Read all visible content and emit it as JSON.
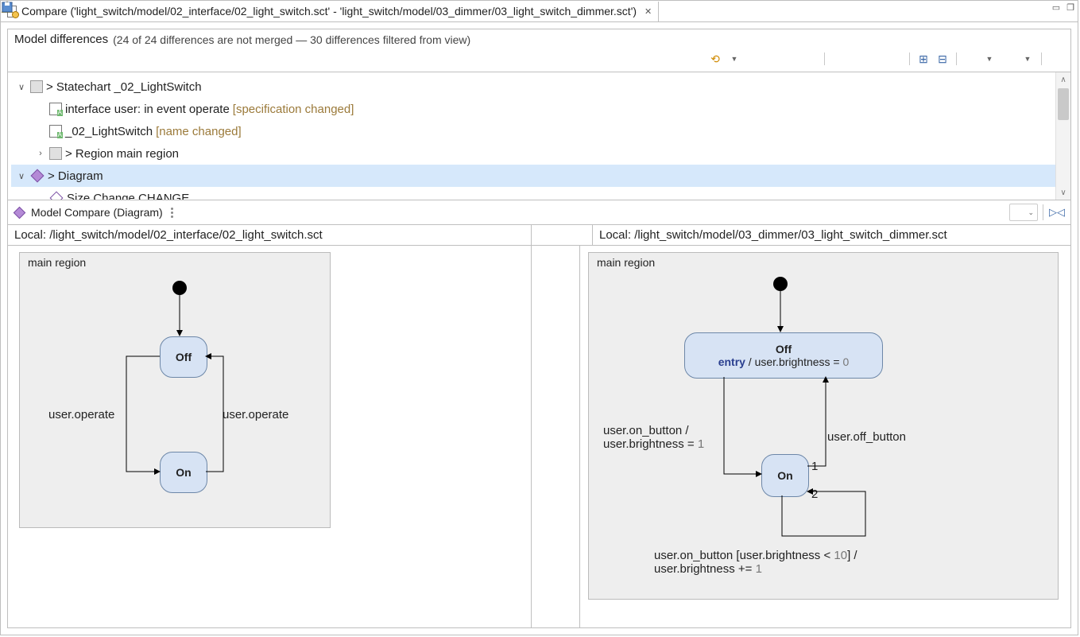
{
  "tab": {
    "title": "Compare ('light_switch/model/02_interface/02_light_switch.sct' - 'light_switch/model/03_dimmer/03_light_switch_dimmer.sct')"
  },
  "header": {
    "title": "Model differences",
    "summary": "(24 of 24 differences are not merged — 30 differences filtered from view)"
  },
  "toolbar": {
    "icons": [
      "undo",
      "dropdown",
      "copy-la",
      "copy-ra",
      "copy-all-l",
      "copy-all-r",
      "sep",
      "accept-l",
      "accept-r",
      "reject-l",
      "reject-r",
      "sep",
      "expand",
      "collapse",
      "sep",
      "group",
      "dropdown",
      "filter",
      "dropdown",
      "sep",
      "save"
    ]
  },
  "tree": {
    "r0_label": "> Statechart _02_LightSwitch",
    "r1_label": "interface user: in event operate",
    "r1_note": "[specification changed]",
    "r2_label": "_02_LightSwitch",
    "r2_note": "[name changed]",
    "r3_label": "> Region main region",
    "r4_label": "> Diagram",
    "r5_label": "Size Change CHANGE"
  },
  "midbar": {
    "title": "Model Compare (Diagram)"
  },
  "paths": {
    "left": "Local: /light_switch/model/02_interface/02_light_switch.sct",
    "right": "Local: /light_switch/model/03_dimmer/03_light_switch_dimmer.sct"
  },
  "left_chart": {
    "region": "main region",
    "off": "Off",
    "on": "On",
    "t1": "user.operate",
    "t2": "user.operate"
  },
  "right_chart": {
    "region": "main region",
    "off": "Off",
    "on": "On",
    "entry_kw": "entry",
    "entry_rest": " / user.brightness = ",
    "entry_zero": "0",
    "t1a": "user.on_button /",
    "t1b": "user.brightness = ",
    "one": "1",
    "t2": "user.off_button",
    "t3a": "user.on_button [user.brightness < ",
    "ten": "10",
    "t3a2": "] /",
    "t3b": "user.brightness += ",
    "one2": "1",
    "p1": "1",
    "p2": "2"
  }
}
